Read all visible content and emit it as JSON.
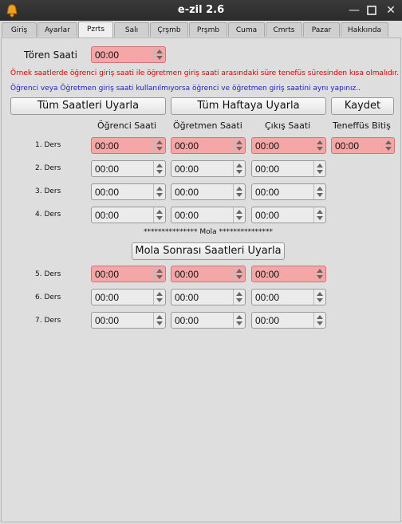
{
  "window": {
    "title": "e-zil 2.6"
  },
  "tabs": [
    "Giriş",
    "Ayarlar",
    "Pzrts",
    "Salı",
    "Çrşmb",
    "Prşmb",
    "Cuma",
    "Cmrts",
    "Pazar",
    "Hakkında"
  ],
  "active_tab": "Pzrts",
  "toren": {
    "label": "Tören Saati",
    "value": "00:00"
  },
  "warnings": {
    "red": "Örnek saatlerde öğrenci giriş saati ile öğretmen giriş saati arasındaki süre tenefüs süresinden kısa olmalıdır.",
    "blue": "Öğrenci veya Öğretmen giriş saati kullanılmıyorsa öğrenci ve öğretmen giriş saatini aynı yapınız.."
  },
  "buttons": {
    "all_times": "Tüm Saatleri Uyarla",
    "whole_week": "Tüm Haftaya Uyarla",
    "save": "Kaydet",
    "after_break": "Mola Sonrası Saatleri Uyarla"
  },
  "columns": [
    "Öğrenci Saati",
    "Öğretmen Saati",
    "Çıkış Saati",
    "Teneffüs Bitiş"
  ],
  "lessons": [
    {
      "label": "1. Ders",
      "student": "00:00",
      "teacher": "00:00",
      "exit": "00:00",
      "break_end": "00:00"
    },
    {
      "label": "2. Ders",
      "student": "00:00",
      "teacher": "00:00",
      "exit": "00:00"
    },
    {
      "label": "3. Ders",
      "student": "00:00",
      "teacher": "00:00",
      "exit": "00:00"
    },
    {
      "label": "4. Ders",
      "student": "00:00",
      "teacher": "00:00",
      "exit": "00:00"
    },
    {
      "label": "5. Ders",
      "student": "00:00",
      "teacher": "00:00",
      "exit": "00:00"
    },
    {
      "label": "6. Ders",
      "student": "00:00",
      "teacher": "00:00",
      "exit": "00:00"
    },
    {
      "label": "7. Ders",
      "student": "00:00",
      "teacher": "00:00",
      "exit": "00:00"
    }
  ],
  "mola_label": "*************** Mola ***************",
  "icons": {
    "app": "bell-icon",
    "minimize": "minimize-icon",
    "maximize": "maximize-icon",
    "close": "close-icon"
  },
  "colors": {
    "highlight": "#f5a7a7",
    "warning_red": "#e00000",
    "warning_blue": "#2222cc"
  }
}
